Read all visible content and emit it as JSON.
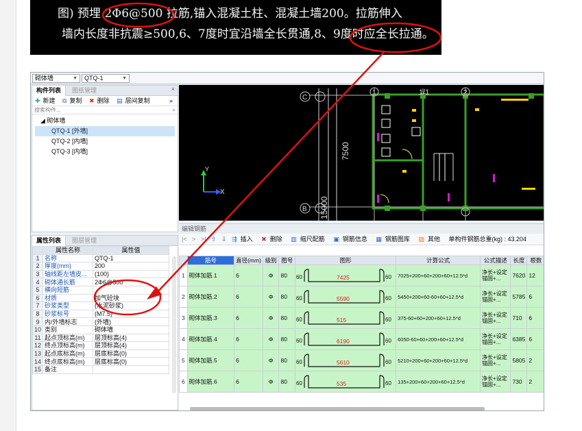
{
  "note": {
    "line1": "图) 预埋 2Φ6@500 拉筋,锚入混凝土柱、混凝土墙200。拉筋伸入",
    "line2": "墙内长度非抗震≥500,6、7度时宜沿墙全长贯通,8、9度时应全长拉通。"
  },
  "topbar": {
    "category": "砌体墙",
    "element": "QTQ-1"
  },
  "component_panel": {
    "tab_active": "构件列表",
    "tab_inactive": "图纸管理",
    "toolbar": [
      "新建",
      "复制",
      "删除",
      "层间复制"
    ],
    "search_placeholder": "搜索构件...",
    "tree_root": "砌体墙",
    "items": [
      "QTQ-1 [外墙]",
      "QTQ-2 [内墙]",
      "QTQ-3 [内墙]"
    ]
  },
  "property_panel": {
    "tab_active": "属性列表",
    "tab_inactive": "图层管理",
    "col_name": "属性名称",
    "col_value": "属性值",
    "rows": [
      {
        "no": "1",
        "name": "名称",
        "value": "QTQ-1"
      },
      {
        "no": "2",
        "name": "厚度(mm)",
        "value": "200"
      },
      {
        "no": "3",
        "name": "轴线距左墙皮...",
        "value": "(100)"
      },
      {
        "no": "4",
        "name": "砌体通长筋",
        "value": "2Φ6@500"
      },
      {
        "no": "5",
        "name": "横向短筋",
        "value": ""
      },
      {
        "no": "6",
        "name": "材质",
        "value": "加气砼块"
      },
      {
        "no": "7",
        "name": "砂浆类型",
        "value": "(水泥砂浆)"
      },
      {
        "no": "8",
        "name": "砂浆标号",
        "value": "(M7.5)"
      },
      {
        "no": "9",
        "name": "内/外墙标志",
        "value": "(外墙)"
      },
      {
        "no": "10",
        "name": "类别",
        "value": "砌体墙"
      },
      {
        "no": "11",
        "name": "起点顶标高(m)",
        "value": "层顶标高(4)"
      },
      {
        "no": "12",
        "name": "终点顶标高(m)",
        "value": "层顶标高(4)"
      },
      {
        "no": "13",
        "name": "起点底标高(m)",
        "value": "层底标高(0)"
      },
      {
        "no": "14",
        "name": "终点底标高(m)",
        "value": "层底标高(0)"
      },
      {
        "no": "15",
        "name": "备注",
        "value": ""
      }
    ]
  },
  "cad": {
    "axis_c": "C",
    "axis_b": "B",
    "dim_7500": "7500",
    "dim_15000": "15000",
    "axis_1": "1",
    "axis_1_1": "1/1",
    "axis_2": "2",
    "x_label": "X",
    "y_label": "Y"
  },
  "rebar_grid": {
    "title": "编辑钢筋",
    "toolbar": [
      "插入",
      "删除",
      "缩尺配筋",
      "钢筋信息",
      "钢筋图库",
      "其他"
    ],
    "weight_label": "单构件钢筋总重(kg) : 43.204",
    "headers": [
      "筋号",
      "直径(mm)",
      "级别",
      "图号",
      "图形",
      "计算公式",
      "公式描述",
      "长度",
      "根数"
    ],
    "rows": [
      {
        "no": "1",
        "name": "砌体加筋.1",
        "dia": "6",
        "grade": "Φ",
        "fig": "80",
        "left": "60",
        "len_label": "7425",
        "right": "60",
        "formula": "7025+200+60+200+60+12.5*d",
        "desc": "净长+设定锚固+...",
        "length": "7620",
        "count": "12"
      },
      {
        "no": "2",
        "name": "砌体加筋.2",
        "dia": "6",
        "grade": "Φ",
        "fig": "80",
        "left": "60",
        "len_label": "5590",
        "right": "60",
        "formula": "5450+200+60-60+60+12.5*d",
        "desc": "净长+设定锚固+...",
        "length": "5785",
        "count": "6"
      },
      {
        "no": "3",
        "name": "砌体加筋.3",
        "dia": "6",
        "grade": "Φ",
        "fig": "80",
        "left": "60",
        "len_label": "515",
        "right": "60",
        "formula": "375-60+60+200+60+12.5*d",
        "desc": "净长+设定锚固+...",
        "length": "710",
        "count": "6"
      },
      {
        "no": "4",
        "name": "砌体加筋.4",
        "dia": "6",
        "grade": "Φ",
        "fig": "80",
        "left": "60",
        "len_label": "6190",
        "right": "60",
        "formula": "6050-60+60+200+60+12.5*d",
        "desc": "净长+设定锚固+...",
        "length": "6385",
        "count": "6"
      },
      {
        "no": "5",
        "name": "砌体加筋.5",
        "dia": "6",
        "grade": "Φ",
        "fig": "80",
        "left": "60",
        "len_label": "5610",
        "right": "60",
        "formula": "5210+200+60+200+60+12.5*d",
        "desc": "净长+设定锚固+...",
        "length": "5805",
        "count": "2"
      },
      {
        "no": "6",
        "name": "砌体加筋.6",
        "dia": "6",
        "grade": "Φ",
        "fig": "80",
        "left": "60",
        "len_label": "535",
        "right": "60",
        "formula": "135+200+60+200+60+12.5*d",
        "desc": "净长+设定锚固+...",
        "length": "730",
        "count": "2"
      }
    ]
  }
}
